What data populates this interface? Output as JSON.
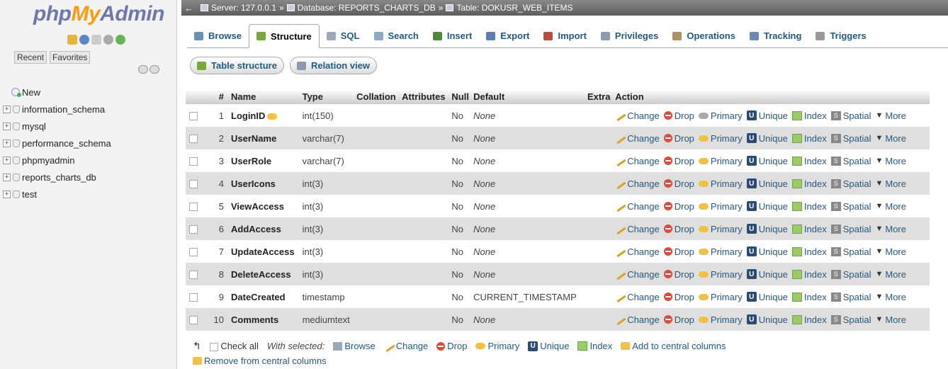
{
  "logo": {
    "part1": "php",
    "part2": "My",
    "part3": "Admin"
  },
  "nav_tabs": [
    "Recent",
    "Favorites"
  ],
  "tree": [
    "New",
    "information_schema",
    "mysql",
    "performance_schema",
    "phpmyadmin",
    "reports_charts_db",
    "test"
  ],
  "breadcrumb": {
    "server": "Server: 127.0.0.1",
    "sep1": "»",
    "database": "Database: REPORTS_CHARTS_DB",
    "sep2": "»",
    "table": "Table: DOKUSR_WEB_ITEMS"
  },
  "tabs": [
    {
      "label": "Browse",
      "icon": "browse-icon",
      "color": "#6c8fb5"
    },
    {
      "label": "Structure",
      "icon": "structure-icon",
      "color": "#7aa83a"
    },
    {
      "label": "SQL",
      "icon": "sql-icon",
      "color": "#9aa9bc"
    },
    {
      "label": "Search",
      "icon": "search-icon",
      "color": "#8ca8c6"
    },
    {
      "label": "Insert",
      "icon": "insert-icon",
      "color": "#4e8a3a"
    },
    {
      "label": "Export",
      "icon": "export-icon",
      "color": "#5b7db0"
    },
    {
      "label": "Import",
      "icon": "import-icon",
      "color": "#c04a3a"
    },
    {
      "label": "Privileges",
      "icon": "privileges-icon",
      "color": "#8a9ab0"
    },
    {
      "label": "Operations",
      "icon": "operations-icon",
      "color": "#b09060"
    },
    {
      "label": "Tracking",
      "icon": "tracking-icon",
      "color": "#6a8ab0"
    },
    {
      "label": "Triggers",
      "icon": "triggers-icon",
      "color": "#999999"
    }
  ],
  "subtabs": {
    "table_structure": "Table structure",
    "relation_view": "Relation view"
  },
  "columns": {
    "num": "#",
    "name": "Name",
    "type": "Type",
    "collation": "Collation",
    "attributes": "Attributes",
    "null": "Null",
    "default": "Default",
    "extra": "Extra",
    "action": "Action"
  },
  "rows": [
    {
      "num": "1",
      "name": "LoginID",
      "type": "int(150)",
      "null": "No",
      "default": "None",
      "primary": true
    },
    {
      "num": "2",
      "name": "UserName",
      "type": "varchar(7)",
      "null": "No",
      "default": "None"
    },
    {
      "num": "3",
      "name": "UserRole",
      "type": "varchar(7)",
      "null": "No",
      "default": "None"
    },
    {
      "num": "4",
      "name": "UserIcons",
      "type": "int(3)",
      "null": "No",
      "default": "None"
    },
    {
      "num": "5",
      "name": "ViewAccess",
      "type": "int(3)",
      "null": "No",
      "default": "None"
    },
    {
      "num": "6",
      "name": "AddAccess",
      "type": "int(3)",
      "null": "No",
      "default": "None"
    },
    {
      "num": "7",
      "name": "UpdateAccess",
      "type": "int(3)",
      "null": "No",
      "default": "None"
    },
    {
      "num": "8",
      "name": "DeleteAccess",
      "type": "int(3)",
      "null": "No",
      "default": "None"
    },
    {
      "num": "9",
      "name": "DateCreated",
      "type": "timestamp",
      "null": "No",
      "default": "CURRENT_TIMESTAMP",
      "default_plain": true
    },
    {
      "num": "10",
      "name": "Comments",
      "type": "mediumtext",
      "null": "No",
      "default": "None"
    }
  ],
  "actions": {
    "change": "Change",
    "drop": "Drop",
    "primary": "Primary",
    "unique": "Unique",
    "index": "Index",
    "spatial": "Spatial",
    "more": "More"
  },
  "footer": {
    "check_all": "Check all",
    "with_selected": "With selected:",
    "browse": "Browse",
    "change": "Change",
    "drop": "Drop",
    "primary": "Primary",
    "unique": "Unique",
    "index": "Index",
    "add_central": "Add to central columns",
    "remove_central": "Remove from central columns"
  }
}
